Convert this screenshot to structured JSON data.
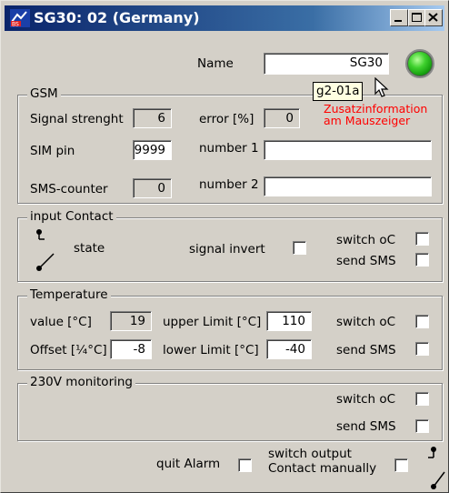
{
  "window": {
    "title": "SG30: 02 (Germany)",
    "title_bar_color": "#0a246a"
  },
  "header": {
    "name_label": "Name",
    "name_value": "SG30",
    "status_led_color": "#3fd12e"
  },
  "tooltip": {
    "text": "g2-01a",
    "hint_line1": "Zusatzinformation",
    "hint_line2": "am Mauszeiger",
    "hint_color": "#ff0000"
  },
  "gsm": {
    "title": "GSM",
    "signal_label": "Signal strenght",
    "signal_value": "6",
    "error_label": "error [%]",
    "error_value": "0",
    "simpin_label": "SIM pin",
    "simpin_value": "9999",
    "number1_label": "number 1",
    "number1_value": "",
    "smscounter_label": "SMS-counter",
    "smscounter_value": "0",
    "number2_label": "number 2",
    "number2_value": ""
  },
  "input_contact": {
    "title": "input Contact",
    "state_label": "state",
    "signal_invert_label": "signal invert",
    "signal_invert_checked": false,
    "switch_oc_label": "switch oC",
    "switch_oc_checked": false,
    "send_sms_label": "send SMS",
    "send_sms_checked": false
  },
  "temperature": {
    "title": "Temperature",
    "value_label": "value [°C]",
    "value": "19",
    "upper_limit_label": "upper Limit [°C]",
    "upper_limit": "110",
    "switch_oc_label": "switch oC",
    "switch_oc_checked": false,
    "offset_label": "Offset [¼°C]",
    "offset": "-8",
    "lower_limit_label": "lower Limit [°C]",
    "lower_limit": "-40",
    "send_sms_label": "send SMS",
    "send_sms_checked": false
  },
  "monitoring_230v": {
    "title": "230V monitoring",
    "switch_oc_label": "switch oC",
    "switch_oc_checked": false,
    "send_sms_label": "send SMS",
    "send_sms_checked": false
  },
  "footer": {
    "quit_alarm_label": "quit Alarm",
    "quit_alarm_checked": false,
    "switch_output_line1": "switch output",
    "switch_output_line2": "Contact manually",
    "switch_output_checked": false
  }
}
